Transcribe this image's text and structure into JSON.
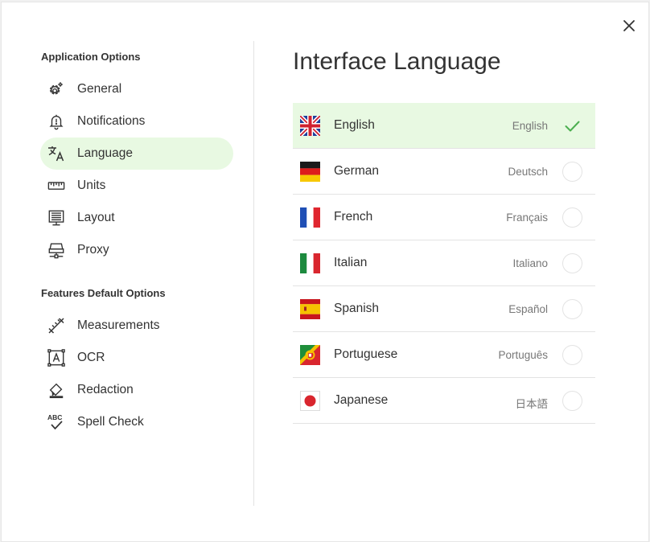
{
  "dialog": {
    "close_icon": "close-icon"
  },
  "sidebar": {
    "sections": [
      {
        "heading": "Application Options",
        "items": [
          {
            "label": "General",
            "icon": "gear-icon",
            "active": false
          },
          {
            "label": "Notifications",
            "icon": "bell-icon",
            "active": false
          },
          {
            "label": "Language",
            "icon": "translate-icon",
            "active": true
          },
          {
            "label": "Units",
            "icon": "ruler-icon",
            "active": false
          },
          {
            "label": "Layout",
            "icon": "layout-icon",
            "active": false
          },
          {
            "label": "Proxy",
            "icon": "proxy-icon",
            "active": false
          }
        ]
      },
      {
        "heading": "Features Default Options",
        "items": [
          {
            "label": "Measurements",
            "icon": "measure-icon",
            "active": false
          },
          {
            "label": "OCR",
            "icon": "ocr-icon",
            "active": false
          },
          {
            "label": "Redaction",
            "icon": "eraser-icon",
            "active": false
          },
          {
            "label": "Spell Check",
            "icon": "spellcheck-icon",
            "active": false
          }
        ]
      }
    ]
  },
  "content": {
    "title": "Interface Language",
    "languages": [
      {
        "name": "English",
        "native": "English",
        "flag": "uk-flag-icon",
        "selected": true
      },
      {
        "name": "German",
        "native": "Deutsch",
        "flag": "germany-flag-icon",
        "selected": false
      },
      {
        "name": "French",
        "native": "Français",
        "flag": "france-flag-icon",
        "selected": false
      },
      {
        "name": "Italian",
        "native": "Italiano",
        "flag": "italy-flag-icon",
        "selected": false
      },
      {
        "name": "Spanish",
        "native": "Español",
        "flag": "spain-flag-icon",
        "selected": false
      },
      {
        "name": "Portuguese",
        "native": "Português",
        "flag": "portugal-flag-icon",
        "selected": false
      },
      {
        "name": "Japanese",
        "native": "日本語",
        "flag": "japan-flag-icon",
        "selected": false
      }
    ]
  },
  "colors": {
    "accent": "#4caf50",
    "selected_bg": "#e8f9e2",
    "divider": "#e3e3e3"
  }
}
